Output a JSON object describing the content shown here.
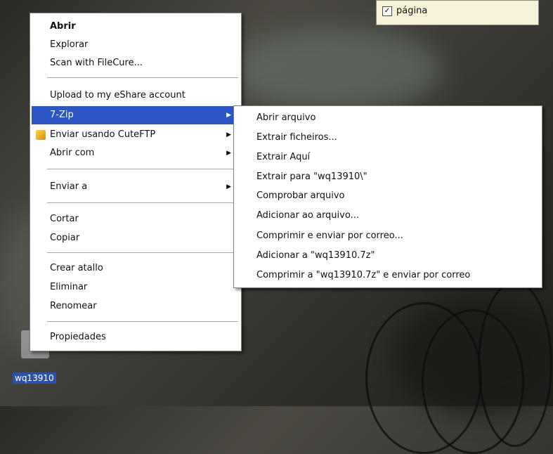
{
  "window_fragment": {
    "checkbox": "✓",
    "label": "página"
  },
  "desktop_icon": {
    "label": "wq13910"
  },
  "context_menu": {
    "items": [
      {
        "label": "Abrir"
      },
      {
        "label": "Explorar"
      },
      {
        "label": "Scan with FileCure..."
      },
      {
        "label": "Upload to my eShare account"
      },
      {
        "label": "7-Zip",
        "submenu": "▶"
      },
      {
        "label": "Enviar usando CuteFTP",
        "submenu": "▶"
      },
      {
        "label": "Abrir com",
        "submenu": "▶"
      },
      {
        "label": "Enviar a",
        "submenu": "▶"
      },
      {
        "label": "Cortar"
      },
      {
        "label": "Copiar"
      },
      {
        "label": "Crear atallo"
      },
      {
        "label": "Eliminar"
      },
      {
        "label": "Renomear"
      },
      {
        "label": "Propiedades"
      }
    ]
  },
  "submenu_7zip": {
    "items": [
      "Abrir arquivo",
      "Extrair ficheiros...",
      "Extrair Aquí",
      "Extrair para \"wq13910\\\"",
      "Comprobar arquivo",
      "Adicionar ao arquivo...",
      "Comprimir e enviar por correo...",
      "Adicionar a \"wq13910.7z\"",
      "Comprimir a \"wq13910.7z\" e enviar por correo"
    ]
  },
  "colors": {
    "selection": "#2c55c6",
    "desktop_selection": "#2d50a8"
  }
}
